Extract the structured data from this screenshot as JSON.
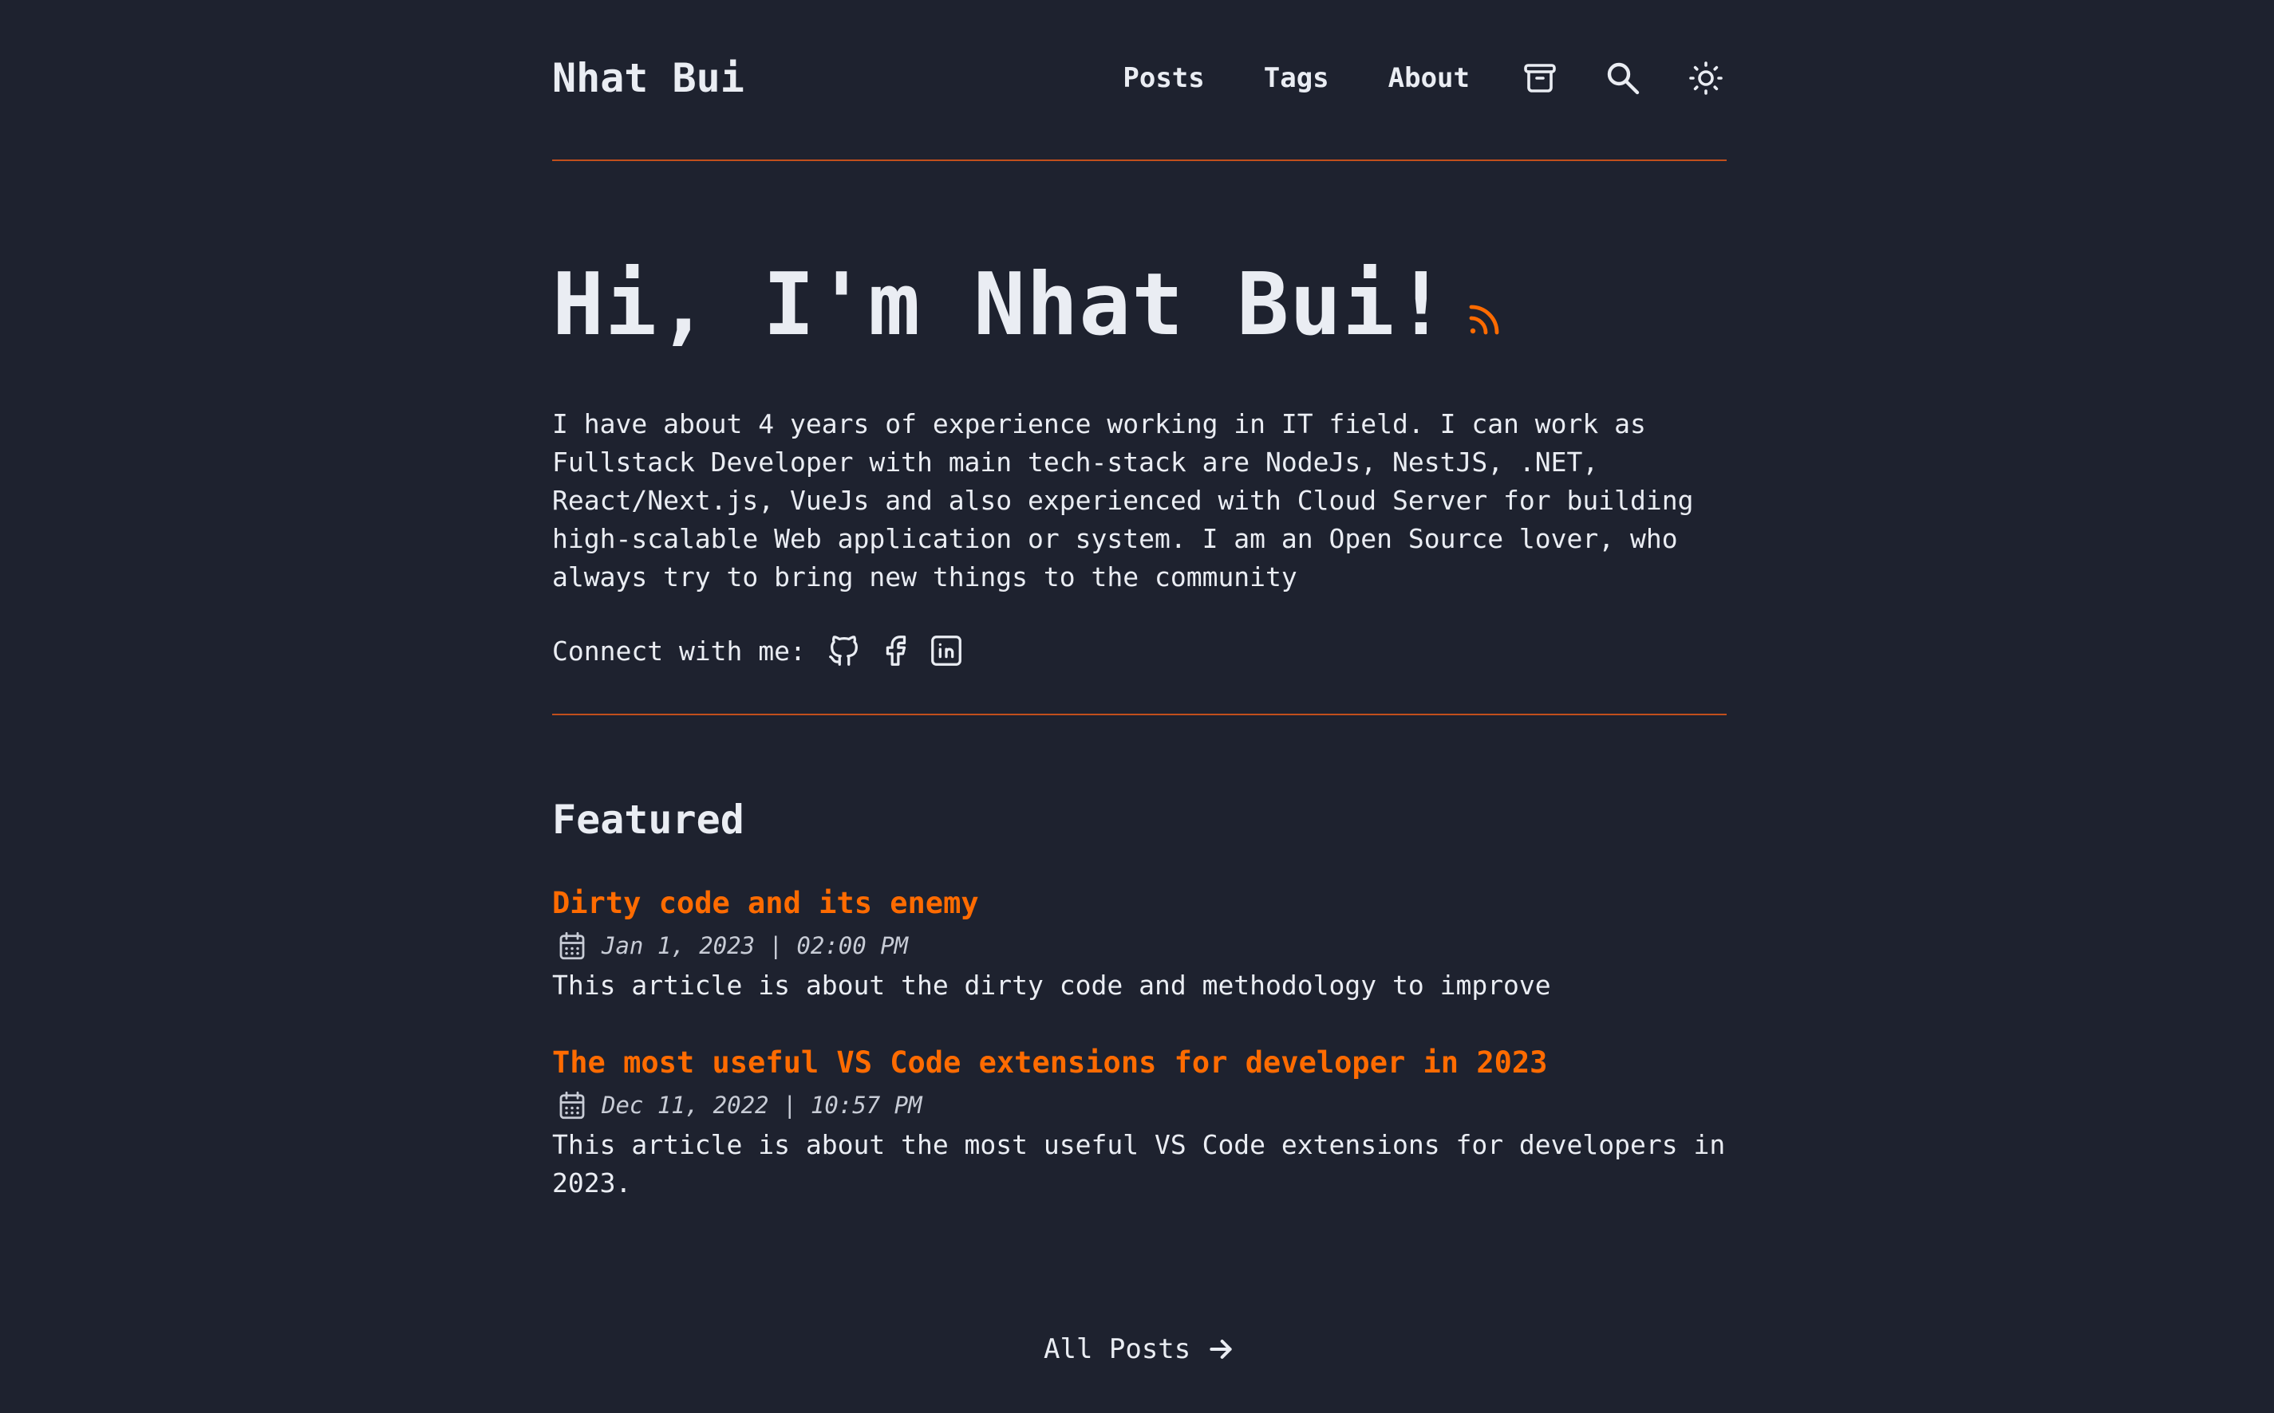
{
  "header": {
    "site_title": "Nhat Bui",
    "nav": [
      {
        "label": "Posts"
      },
      {
        "label": "Tags"
      },
      {
        "label": "About"
      }
    ],
    "icons": [
      "archive-icon",
      "search-icon",
      "theme-toggle-icon"
    ]
  },
  "hero": {
    "title": "Hi, I'm Nhat Bui!",
    "rss_icon": "rss-icon",
    "bio": "I have about 4 years of experience working in IT field. I can work as Fullstack Developer with main tech-stack are NodeJs, NestJS, .NET, React/Next.js, VueJs and also experienced with Cloud Server for building high-scalable Web application or system. I am an Open Source lover, who always try to bring new things to the community",
    "connect_label": "Connect with me:",
    "socials": [
      "github-icon",
      "facebook-icon",
      "linkedin-icon"
    ]
  },
  "featured": {
    "heading": "Featured",
    "posts": [
      {
        "title": "Dirty code and its enemy",
        "date": "Jan 1, 2023 | 02:00 PM",
        "description": "This article is about the dirty code and methodology to improve"
      },
      {
        "title": "The most useful VS Code extensions for developer in 2023",
        "date": "Dec 11, 2022 | 10:57 PM",
        "description": "This article is about the most useful VS Code extensions for developers in 2023."
      }
    ]
  },
  "footer_link": {
    "label": "All Posts"
  },
  "colors": {
    "background": "#1e222f",
    "text": "#eaedf3",
    "accent": "#ff6b01",
    "divider": "#c14f1c"
  }
}
